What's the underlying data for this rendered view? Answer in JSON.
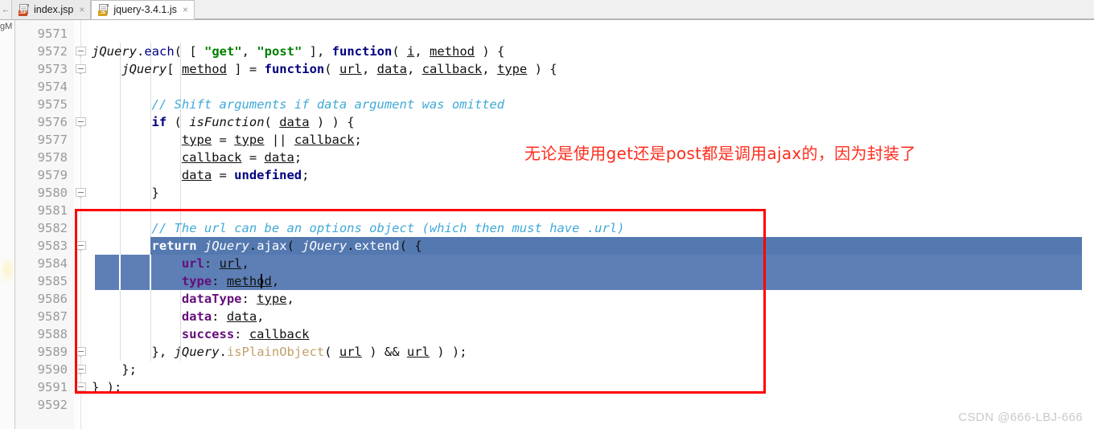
{
  "window": {
    "title": "jquery-3.4.1.js",
    "scroll_arrow": "←"
  },
  "tabs": [
    {
      "label": "index.jsp",
      "icon": "jsp-file-icon",
      "badge": "JSP",
      "active": false,
      "close": "×"
    },
    {
      "label": "jquery-3.4.1.js",
      "icon": "js-file-icon",
      "badge": "JS",
      "active": true,
      "close": "×"
    }
  ],
  "left_strip": {
    "label": "gM"
  },
  "editor": {
    "first_line_number": 9571,
    "line_height": 22,
    "font_size": "15.5px",
    "colors": {
      "background": "#ffffff",
      "gutter_background": "#f7f7f7",
      "line_number": "#9a9a9a",
      "selection": "#5478b0",
      "selection_text": "#ffffff",
      "keyword": "#00007f",
      "string": "#008000",
      "comment": "#3fa9d8",
      "object_key": "#660e7a",
      "function_name": "#c0a16b",
      "annotation_red": "#ff0000",
      "indent_guide": "#dcdcdc"
    },
    "lines": [
      {
        "num": 9571,
        "tokens": []
      },
      {
        "num": 9572,
        "fold": true,
        "tokens": [
          {
            "t": "jQuery",
            "c": "t-italic"
          },
          {
            "t": ".",
            "c": "t-plain"
          },
          {
            "t": "each",
            "c": "t-prop"
          },
          {
            "t": "( [ ",
            "c": "t-plain"
          },
          {
            "t": "\"get\"",
            "c": "t-str"
          },
          {
            "t": ", ",
            "c": "t-plain"
          },
          {
            "t": "\"post\"",
            "c": "t-str"
          },
          {
            "t": " ], ",
            "c": "t-plain"
          },
          {
            "t": "function",
            "c": "t-kw"
          },
          {
            "t": "( ",
            "c": "t-plain"
          },
          {
            "t": "i",
            "c": "t-var"
          },
          {
            "t": ", ",
            "c": "t-plain"
          },
          {
            "t": "method",
            "c": "t-var"
          },
          {
            "t": " ) {",
            "c": "t-plain"
          }
        ]
      },
      {
        "num": 9573,
        "fold": true,
        "indent": 1,
        "tokens": [
          {
            "t": "jQuery",
            "c": "t-italic"
          },
          {
            "t": "[ ",
            "c": "t-plain"
          },
          {
            "t": "method",
            "c": "t-var"
          },
          {
            "t": " ] = ",
            "c": "t-plain"
          },
          {
            "t": "function",
            "c": "t-kw"
          },
          {
            "t": "( ",
            "c": "t-plain"
          },
          {
            "t": "url",
            "c": "t-var"
          },
          {
            "t": ", ",
            "c": "t-plain"
          },
          {
            "t": "data",
            "c": "t-var"
          },
          {
            "t": ", ",
            "c": "t-plain"
          },
          {
            "t": "callback",
            "c": "t-var"
          },
          {
            "t": ", ",
            "c": "t-plain"
          },
          {
            "t": "type",
            "c": "t-var"
          },
          {
            "t": " ) {",
            "c": "t-plain"
          }
        ]
      },
      {
        "num": 9574,
        "tokens": []
      },
      {
        "num": 9575,
        "indent": 2,
        "tokens": [
          {
            "t": "// Shift arguments if data argument was omitted",
            "c": "t-cmt"
          }
        ]
      },
      {
        "num": 9576,
        "fold": true,
        "indent": 2,
        "tokens": [
          {
            "t": "if",
            "c": "t-kw"
          },
          {
            "t": " ( ",
            "c": "t-plain"
          },
          {
            "t": "isFunction",
            "c": "t-italic"
          },
          {
            "t": "( ",
            "c": "t-plain"
          },
          {
            "t": "data",
            "c": "t-var"
          },
          {
            "t": " ) ) {",
            "c": "t-plain"
          }
        ]
      },
      {
        "num": 9577,
        "indent": 3,
        "tokens": [
          {
            "t": "type",
            "c": "t-var"
          },
          {
            "t": " = ",
            "c": "t-plain"
          },
          {
            "t": "type",
            "c": "t-var"
          },
          {
            "t": " || ",
            "c": "t-plain"
          },
          {
            "t": "callback",
            "c": "t-var"
          },
          {
            "t": ";",
            "c": "t-plain"
          }
        ]
      },
      {
        "num": 9578,
        "indent": 3,
        "tokens": [
          {
            "t": "callback",
            "c": "t-var"
          },
          {
            "t": " = ",
            "c": "t-plain"
          },
          {
            "t": "data",
            "c": "t-var"
          },
          {
            "t": ";",
            "c": "t-plain"
          }
        ]
      },
      {
        "num": 9579,
        "indent": 3,
        "tokens": [
          {
            "t": "data",
            "c": "t-var"
          },
          {
            "t": " = ",
            "c": "t-plain"
          },
          {
            "t": "undefined",
            "c": "t-kw"
          },
          {
            "t": ";",
            "c": "t-plain"
          }
        ]
      },
      {
        "num": 9580,
        "fold": true,
        "indent": 2,
        "tokens": [
          {
            "t": "}",
            "c": "t-plain"
          }
        ]
      },
      {
        "num": 9581,
        "tokens": []
      },
      {
        "num": 9582,
        "indent": 2,
        "tokens": [
          {
            "t": "// The url can be an options object (which then must have .url)",
            "c": "t-cmt"
          }
        ]
      },
      {
        "num": 9583,
        "fold": true,
        "indent": 2,
        "selected": "full",
        "tokens": [
          {
            "t": "return",
            "c": "t-kw"
          },
          {
            "t": " ",
            "c": "t-plain"
          },
          {
            "t": "jQuery",
            "c": "t-italic"
          },
          {
            "t": ".",
            "c": "t-plain"
          },
          {
            "t": "ajax",
            "c": "t-prop"
          },
          {
            "t": "( ",
            "c": "t-plain"
          },
          {
            "t": "jQuery",
            "c": "t-italic"
          },
          {
            "t": ".",
            "c": "t-plain"
          },
          {
            "t": "extend",
            "c": "t-prop"
          },
          {
            "t": "( {",
            "c": "t-plain"
          }
        ]
      },
      {
        "num": 9584,
        "indent": 3,
        "selected": "partial",
        "tokens": [
          {
            "t": "url",
            "c": "t-key"
          },
          {
            "t": ": ",
            "c": "t-plain"
          },
          {
            "t": "url",
            "c": "t-var"
          },
          {
            "t": ",",
            "c": "t-plain"
          }
        ]
      },
      {
        "num": 9585,
        "indent": 3,
        "selected": "partial",
        "caret": true,
        "tokens": [
          {
            "t": "type",
            "c": "t-key"
          },
          {
            "t": ": ",
            "c": "t-plain"
          },
          {
            "t": "method",
            "c": "t-var"
          },
          {
            "t": ",",
            "c": "t-plain"
          }
        ]
      },
      {
        "num": 9586,
        "indent": 3,
        "tokens": [
          {
            "t": "dataType",
            "c": "t-key"
          },
          {
            "t": ": ",
            "c": "t-plain"
          },
          {
            "t": "type",
            "c": "t-var"
          },
          {
            "t": ",",
            "c": "t-plain"
          }
        ]
      },
      {
        "num": 9587,
        "indent": 3,
        "tokens": [
          {
            "t": "data",
            "c": "t-key"
          },
          {
            "t": ": ",
            "c": "t-plain"
          },
          {
            "t": "data",
            "c": "t-var"
          },
          {
            "t": ",",
            "c": "t-plain"
          }
        ]
      },
      {
        "num": 9588,
        "indent": 3,
        "tokens": [
          {
            "t": "success",
            "c": "t-key"
          },
          {
            "t": ": ",
            "c": "t-plain"
          },
          {
            "t": "callback",
            "c": "t-var"
          }
        ]
      },
      {
        "num": 9589,
        "fold": true,
        "indent": 2,
        "tokens": [
          {
            "t": "}, ",
            "c": "t-plain"
          },
          {
            "t": "jQuery",
            "c": "t-italic"
          },
          {
            "t": ".",
            "c": "t-plain"
          },
          {
            "t": "isPlainObject",
            "c": "t-fn"
          },
          {
            "t": "( ",
            "c": "t-plain"
          },
          {
            "t": "url",
            "c": "t-var"
          },
          {
            "t": " ) && ",
            "c": "t-plain"
          },
          {
            "t": "url",
            "c": "t-var"
          },
          {
            "t": " ) );",
            "c": "t-plain"
          }
        ]
      },
      {
        "num": 9590,
        "fold": true,
        "indent": 1,
        "tokens": [
          {
            "t": "};",
            "c": "t-plain"
          }
        ]
      },
      {
        "num": 9591,
        "fold": true,
        "tokens": [
          {
            "t": "} );",
            "c": "t-plain"
          }
        ]
      },
      {
        "num": 9592,
        "tokens": []
      }
    ]
  },
  "annotations": {
    "red_note": "无论是使用get还是post都是调用ajax的，因为封装了",
    "red_box_label": "highlight-rectangle"
  },
  "watermark": "CSDN @666-LBJ-666"
}
